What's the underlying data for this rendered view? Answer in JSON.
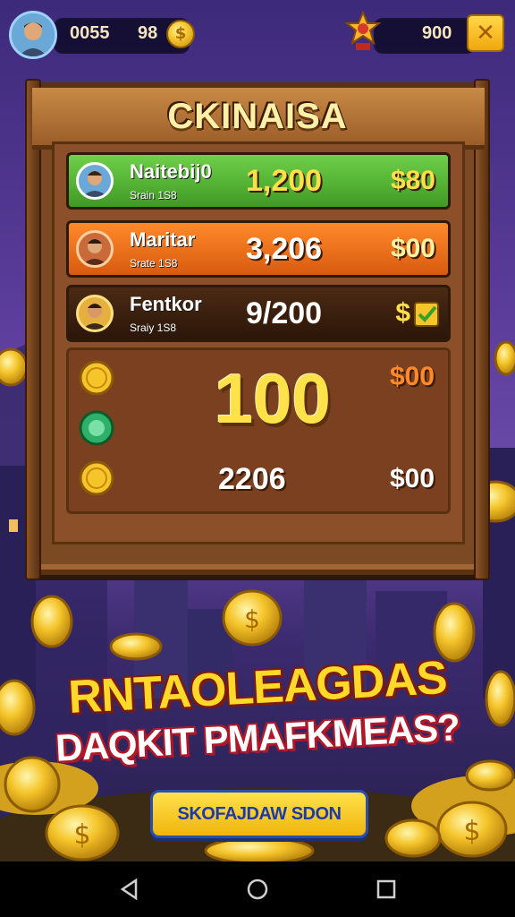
{
  "hud": {
    "coins_value": "0055",
    "gems_value": "98",
    "trophy_value": "900",
    "coin_symbol": "$",
    "close_symbol": "✕"
  },
  "board": {
    "title": "CKINAISA",
    "rows": [
      {
        "name": "Naitebij0",
        "sub": "Srain 1S8",
        "score": "1,200",
        "reward": "$80"
      },
      {
        "name": "Maritar",
        "sub": "Srate 1S8",
        "score": "3,206",
        "reward": "$00"
      },
      {
        "name": "Fentkor",
        "sub": "Sraiy 1S8",
        "score": "9/200",
        "reward": "$"
      }
    ],
    "big_score": "100",
    "big_reward": "$00",
    "bottom_score": "2206",
    "bottom_reward": "$00"
  },
  "promo": {
    "line1": "RNTAOLEAGDAS",
    "line2": "DAQKIT PMAFKMEAS?",
    "cta_label": "SKOFAJDAW SDON"
  },
  "colors": {
    "row1": "#4fb82e",
    "row2": "#f07018",
    "row3": "#3a1f0e",
    "wood": "#7b4a22",
    "gold": "#ffe04a"
  },
  "navbar": {
    "back_icon": "back-triangle-icon",
    "home_icon": "home-circle-icon",
    "recents_icon": "recents-square-icon"
  }
}
